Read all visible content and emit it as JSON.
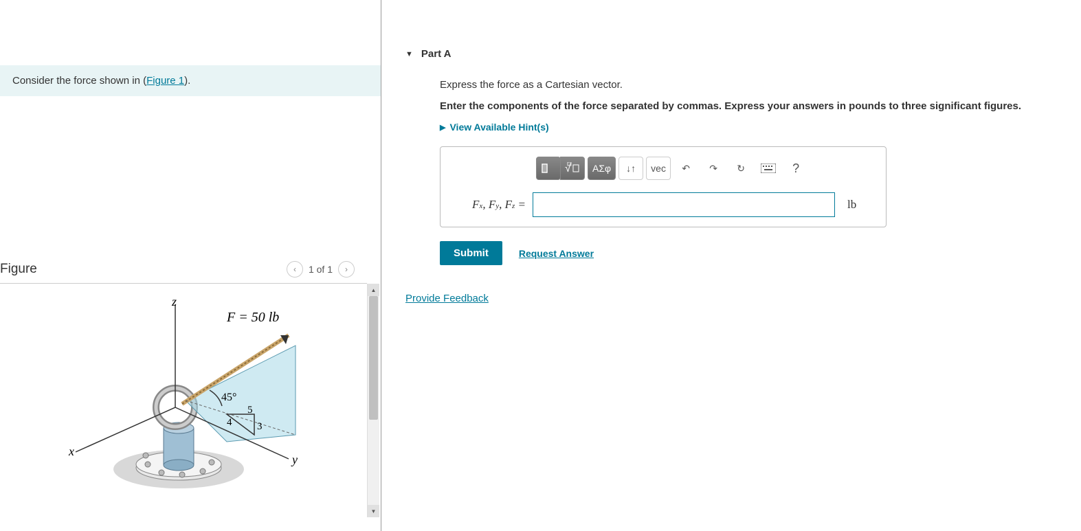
{
  "left": {
    "intro_prefix": "Consider the force shown in (",
    "intro_link": "Figure 1",
    "intro_suffix": ").",
    "figure_title": "Figure",
    "figure_nav": "1 of 1",
    "diagram": {
      "force_label": "F = 50 lb",
      "angle_label": "45°",
      "dim_5": "5",
      "dim_4": "4",
      "dim_3": "3",
      "axis_x": "x",
      "axis_y": "y",
      "axis_z": "z"
    }
  },
  "right": {
    "part_title": "Part A",
    "instruction1": "Express the force as a Cartesian vector.",
    "instruction2": "Enter the components of the force separated by commas. Express your answers in pounds to three significant figures.",
    "hints_label": "View Available Hint(s)",
    "toolbar": {
      "greek": "ΑΣφ",
      "vec": "vec",
      "help": "?"
    },
    "input_label_fx": "F",
    "input_label_sub_x": "x",
    "input_label_sub_y": "y",
    "input_label_sub_z": "z",
    "input_eq": " = ",
    "unit": "lb",
    "submit": "Submit",
    "request": "Request Answer",
    "feedback": "Provide Feedback"
  }
}
